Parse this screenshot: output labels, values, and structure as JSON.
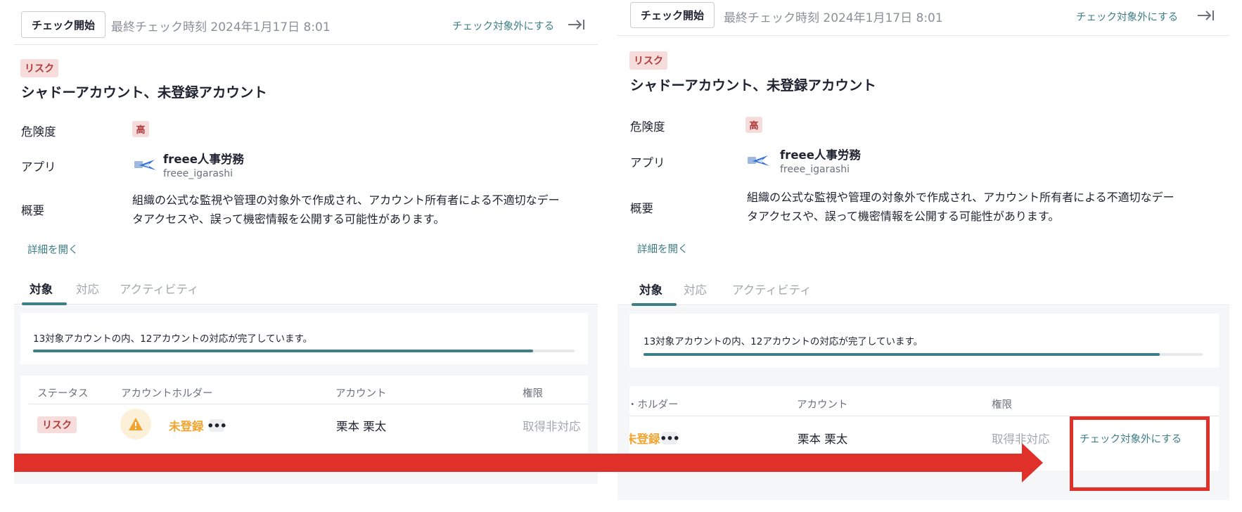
{
  "header": {
    "start_button": "チェック開始",
    "last_check": "最終チェック時刻 2024年1月17日 8:01",
    "exclude_link": "チェック対象外にする"
  },
  "risk_badge": "リスク",
  "title": "シャドーアカウント、未登録アカウント",
  "fields": {
    "severity_label": "危険度",
    "severity_value": "高",
    "app_label": "アプリ",
    "app_name": "freee人事労務",
    "app_account": "freee_igarashi",
    "summary_label": "概要",
    "summary_line1": "組織の公式な監視や管理の対象外で作成され、アカウント所有者による不適切なデー",
    "summary_line2": "タアクセスや、誤って機密情報を公開する可能性があります。"
  },
  "details_link": "詳細を開く",
  "tabs": [
    "対象",
    "対応",
    "アクティビティ"
  ],
  "progress": {
    "text": "13対象アカウントの内、12アカウントの対応が完了しています。",
    "completed": 12,
    "total": 13
  },
  "table": {
    "headers": {
      "status": "ステータス",
      "holder": "アカウントホルダー",
      "holder_clipped": "・ホルダー",
      "account": "アカウント",
      "permission": "権限"
    },
    "row": {
      "status": "リスク",
      "holder": "未登録",
      "holder_clipped": "未登録",
      "more": "•••",
      "account": "栗本 栗太",
      "permission": "取得非対応",
      "action": "チェック対象外にする"
    }
  },
  "colors": {
    "accent": "#3e7f87",
    "risk": "#b03a3a",
    "warning": "#f0a531",
    "annotation_red": "#e0302a"
  }
}
